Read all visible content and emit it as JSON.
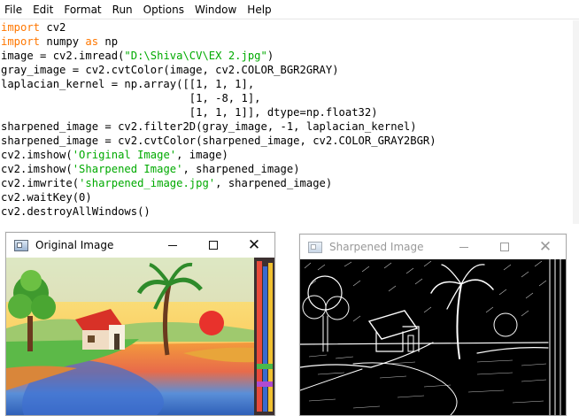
{
  "menubar": {
    "items": [
      "File",
      "Edit",
      "Format",
      "Run",
      "Options",
      "Window",
      "Help"
    ]
  },
  "editor": {
    "lines": [
      [
        {
          "t": "import",
          "k": "kw"
        },
        {
          "t": " cv2",
          "k": "n"
        }
      ],
      [
        {
          "t": "import",
          "k": "kw"
        },
        {
          "t": " numpy ",
          "k": "n"
        },
        {
          "t": "as",
          "k": "kw"
        },
        {
          "t": " np",
          "k": "n"
        }
      ],
      [
        {
          "t": "image = cv2.imread(",
          "k": "n"
        },
        {
          "t": "\"D:\\Shiva\\CV\\EX 2.jpg\"",
          "k": "str"
        },
        {
          "t": ")",
          "k": "n"
        }
      ],
      [
        {
          "t": "gray_image = cv2.cvtColor(image, cv2.COLOR_BGR2GRAY)",
          "k": "n"
        }
      ],
      [
        {
          "t": "laplacian_kernel = np.array([[1, 1, 1],",
          "k": "n"
        }
      ],
      [
        {
          "t": "                             [1, -8, 1],",
          "k": "n"
        }
      ],
      [
        {
          "t": "                             [1, 1, 1]], dtype=np.float32)",
          "k": "n"
        }
      ],
      [
        {
          "t": "sharpened_image = cv2.filter2D(gray_image, -1, laplacian_kernel)",
          "k": "n"
        }
      ],
      [
        {
          "t": "sharpened_image = cv2.cvtColor(sharpened_image, cv2.COLOR_GRAY2BGR)",
          "k": "n"
        }
      ],
      [
        {
          "t": "cv2.imshow(",
          "k": "n"
        },
        {
          "t": "'Original Image'",
          "k": "str"
        },
        {
          "t": ", image)",
          "k": "n"
        }
      ],
      [
        {
          "t": "cv2.imshow(",
          "k": "n"
        },
        {
          "t": "'Sharpened Image'",
          "k": "str"
        },
        {
          "t": ", sharpened_image)",
          "k": "n"
        }
      ],
      [
        {
          "t": "cv2.imwrite(",
          "k": "n"
        },
        {
          "t": "'sharpened_image.jpg'",
          "k": "str"
        },
        {
          "t": ", sharpened_image)",
          "k": "n"
        }
      ],
      [
        {
          "t": "cv2.waitKey(0)",
          "k": "n"
        }
      ],
      [
        {
          "t": "cv2.destroyAllWindows()",
          "k": "n"
        }
      ]
    ]
  },
  "colors": {
    "keyword": "#ff7700",
    "string": "#00aa00"
  },
  "windows": {
    "original": {
      "title": "Original Image",
      "active": true,
      "icons": [
        "app-icon",
        "minimize-icon",
        "maximize-icon",
        "close-icon"
      ]
    },
    "sharpened": {
      "title": "Sharpened Image",
      "active": false,
      "icons": [
        "app-icon",
        "minimize-icon",
        "maximize-icon",
        "close-icon"
      ]
    }
  }
}
